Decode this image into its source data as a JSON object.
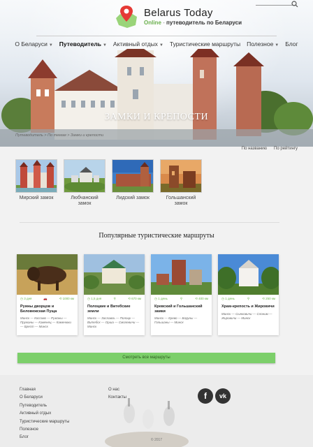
{
  "header": {
    "brand": "Belarus Today",
    "tagline_online": "Online",
    "tagline_sep": " - ",
    "tagline_text": "путеводитель по Беларуси"
  },
  "nav": [
    {
      "label": "О Беларуси",
      "caret": true,
      "active": false
    },
    {
      "label": "Путеводитель",
      "caret": true,
      "active": true
    },
    {
      "label": "Активный отдых",
      "caret": true,
      "active": false
    },
    {
      "label": "Туристические маршруты",
      "caret": false,
      "active": false
    },
    {
      "label": "Полезное",
      "caret": true,
      "active": false
    },
    {
      "label": "Блог",
      "caret": false,
      "active": false
    }
  ],
  "hero": {
    "title": "ЗАМКИ И КРЕПОСТИ"
  },
  "breadcrumb": "Путеводитель > По темам > Замки и крепости",
  "sort": {
    "by_name": "По названию",
    "by_rating": "По рейтингу"
  },
  "castles": [
    {
      "label": "Мирский замок"
    },
    {
      "label": "Любчанский замок"
    },
    {
      "label": "Лидский замок"
    },
    {
      "label": "Гольшанский замок"
    }
  ],
  "routes_title": "Популярные туристические маршруты",
  "routes": [
    {
      "days": "3 дня",
      "km": "1000 км",
      "title": "Руины дворцов и Беловежская Пуща",
      "desc": "Минск — Коссово — Ружаны — Пружаны — Каменец — Каменюки — Брест — Минск"
    },
    {
      "days": "1,5 дня",
      "km": "670 км",
      "title": "Полоцкие и Витебские земли",
      "desc": "Минск — Заславль — Полоцк — Витебск — Орша — Смолевичи — Минск"
    },
    {
      "days": "1 день",
      "km": "400 км",
      "title": "Кревский и Гольшанский замки",
      "desc": "Минск — Крево — Боруны — Гольшаны — Минск"
    },
    {
      "days": "1 день",
      "km": "250 км",
      "title": "Храм-крепость и Жировичи",
      "desc": "Минск — Сынковичи — Слоним — Жировичи — Минск"
    }
  ],
  "see_all": "Смотреть все маршруты",
  "footer": {
    "col1": [
      "Главная",
      "О Беларуси",
      "Путеводитель",
      "Активный отдых",
      "Туристические маршруты",
      "Полезное",
      "Блог"
    ],
    "col2": [
      "О нас",
      "Контакты"
    ],
    "facebook": "f",
    "vk": "vk",
    "copyright": "© 2017"
  }
}
